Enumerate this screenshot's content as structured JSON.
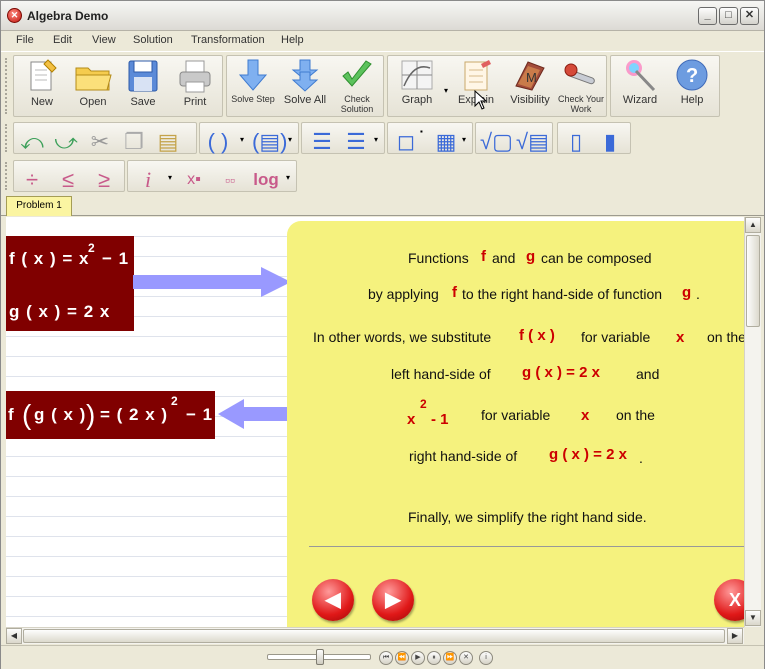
{
  "window": {
    "title": "Algebra Demo",
    "icon": "x-logo-icon"
  },
  "window_controls": {
    "minimize": "_",
    "maximize": "□",
    "close": "✕"
  },
  "menu": [
    "File",
    "Edit",
    "View",
    "Solution",
    "Transformation",
    "Help"
  ],
  "toolbar_main": {
    "new": "New",
    "open": "Open",
    "save": "Save",
    "print": "Print",
    "solve_step": "Solve Step",
    "solve_all": "Solve All",
    "check_solution": "Check Solution",
    "graph": "Graph",
    "explain": "Explain",
    "visibility": "Visibility",
    "check_work": "Check Your Work",
    "wizard": "Wizard",
    "help": "Help"
  },
  "toolbar_third": {
    "log": "log"
  },
  "tabs": [
    "Problem 1"
  ],
  "equations": {
    "fx": {
      "lhs": "f ( x ) =",
      "base": "x",
      "exp": "2",
      "rest": "− 1"
    },
    "gx": {
      "text": "g ( x ) = 2 x"
    },
    "composed": {
      "lhs": "f",
      "inner": "g ( x )",
      "eq": "= ( 2 x )",
      "exp": "2",
      "rest": "− 1"
    }
  },
  "explanation": {
    "l1a": "Functions",
    "l1f": "f",
    "l1and": "and",
    "l1g": "g",
    "l1b": "can be composed",
    "l2a": "by applying",
    "l2f": "f",
    "l2b": "to the right hand-side of function",
    "l2g": "g",
    "l2dot": ".",
    "l3a": "In other words, we substitute",
    "l3fx": "f ( x )",
    "l3b": "for variable",
    "l3x": "x",
    "l3c": "on the",
    "l4a": "left hand-side of",
    "l4g": "g ( x ) = 2 x",
    "l4b": "and",
    "l5x": "x",
    "l5exp": "2",
    "l5m": "- 1",
    "l5b": "for variable",
    "l5var": "x",
    "l5c": "on the",
    "l6a": "right hand-side of",
    "l6g": "g ( x ) = 2 x",
    "l6dot": ".",
    "l7": "Finally, we simplify the right hand side."
  },
  "nav": {
    "prev": "◀",
    "next": "▶",
    "close": "X"
  },
  "colors": {
    "eq_box": "#800000",
    "panel": "#f5f27e",
    "accent_red": "#cc0000",
    "arrow": "#9999ff"
  }
}
